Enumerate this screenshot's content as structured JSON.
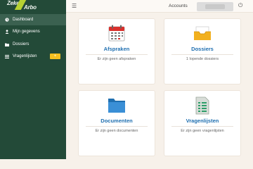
{
  "brand": {
    "part1": "Zeker",
    "part2": "Arbo"
  },
  "sidebar": {
    "items": [
      {
        "label": "Dashboard",
        "icon": "dashboard-icon"
      },
      {
        "label": "Mijn gegevens",
        "icon": "user-icon"
      },
      {
        "label": "Dossiers",
        "icon": "folder-icon"
      },
      {
        "label": "Vragenlijsten",
        "icon": "list-icon"
      }
    ]
  },
  "topbar": {
    "accounts_label": "Accounts"
  },
  "cards": [
    {
      "title": "Afspraken",
      "subtitle": "Er zijn geen afspraken",
      "icon": "calendar-icon"
    },
    {
      "title": "Dossiers",
      "subtitle": "1 lopende dossiers",
      "icon": "inbox-tray-icon"
    },
    {
      "title": "Documenten",
      "subtitle": "Er zijn geen documenten",
      "icon": "folder-icon"
    },
    {
      "title": "Vragenlijsten",
      "subtitle": "Er zijn geen vragenlijsten",
      "icon": "checklist-icon"
    }
  ],
  "colors": {
    "sidebar": "#234a38",
    "accent": "#b7d232",
    "title": "#1f6fb0",
    "badge": "#f4c020"
  }
}
